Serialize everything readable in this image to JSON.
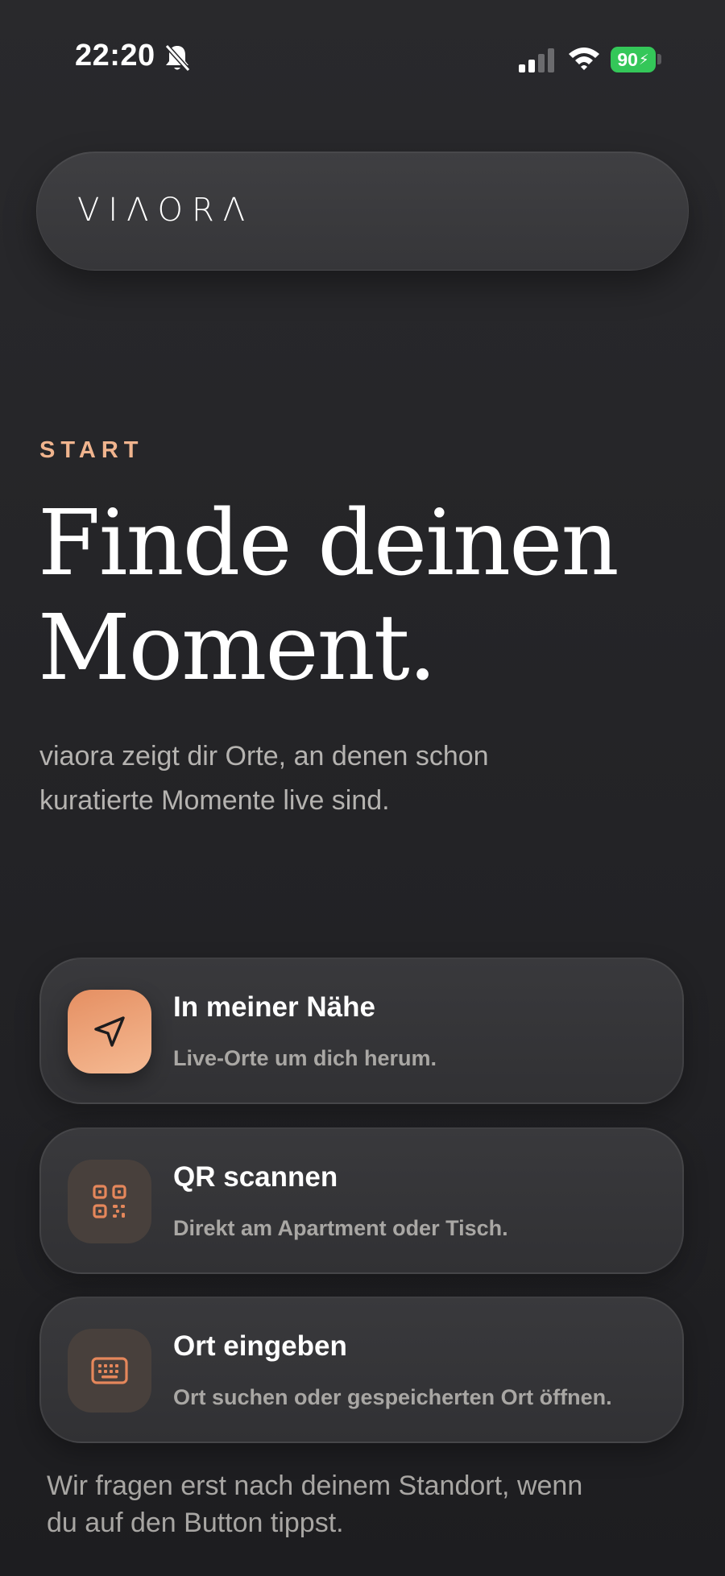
{
  "status_bar": {
    "time": "22:20",
    "battery": "90"
  },
  "header": {
    "logo": "VIΛORΛ"
  },
  "hero": {
    "eyebrow": "START",
    "headline_line1": "Finde deinen",
    "headline_line2": "Moment.",
    "subtitle_line1": "viaora zeigt dir Orte, an denen schon",
    "subtitle_line2": "kuratierte Momente live sind."
  },
  "actions": [
    {
      "title": "In meiner Nähe",
      "description": "Live-Orte um dich herum.",
      "icon": "navigation-arrow-icon"
    },
    {
      "title": "QR scannen",
      "description": "Direkt am Apartment oder Tisch.",
      "icon": "qr-code-icon"
    },
    {
      "title": "Ort eingeben",
      "description": "Ort suchen oder gespeicherten Ort öffnen.",
      "icon": "keyboard-icon"
    }
  ],
  "footnote": {
    "line1": "Wir fragen erst nach deinem Standort, wenn",
    "line2": "du auf den Button tippst."
  },
  "colors": {
    "accent": "#f0b48e",
    "accent_gradient_start": "#e58f62",
    "battery_green": "#34c759",
    "background": "#242427"
  }
}
